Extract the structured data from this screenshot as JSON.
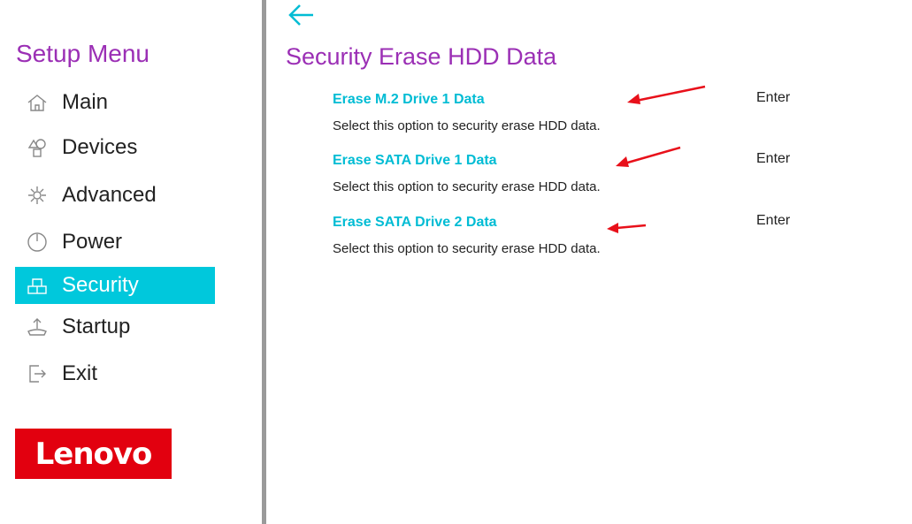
{
  "sidebar": {
    "title": "Setup Menu",
    "items": [
      {
        "label": "Main",
        "icon": "home-icon",
        "active": false
      },
      {
        "label": "Devices",
        "icon": "devices-icon",
        "active": false
      },
      {
        "label": "Advanced",
        "icon": "advanced-icon",
        "active": false
      },
      {
        "label": "Power",
        "icon": "power-icon",
        "active": false
      },
      {
        "label": "Security",
        "icon": "security-icon",
        "active": true
      },
      {
        "label": "Startup",
        "icon": "startup-icon",
        "active": false
      },
      {
        "label": "Exit",
        "icon": "exit-icon",
        "active": false
      }
    ],
    "logo_text": "Lenovo"
  },
  "main": {
    "title": "Security Erase HDD Data",
    "options": [
      {
        "label": "Erase M.2 Drive 1 Data",
        "description": "Select this option to security erase HDD data.",
        "value": "Enter"
      },
      {
        "label": "Erase SATA Drive 1 Data",
        "description": "Select this option to security erase HDD data.",
        "value": "Enter"
      },
      {
        "label": "Erase SATA Drive 2 Data",
        "description": "Select this option to security erase HDD data.",
        "value": "Enter"
      }
    ]
  },
  "colors": {
    "accent": "#00c8dc",
    "title": "#9b2fb5",
    "option_label": "#00bcd4",
    "brand": "#e2000f",
    "annotation_arrow": "#e8101a"
  }
}
